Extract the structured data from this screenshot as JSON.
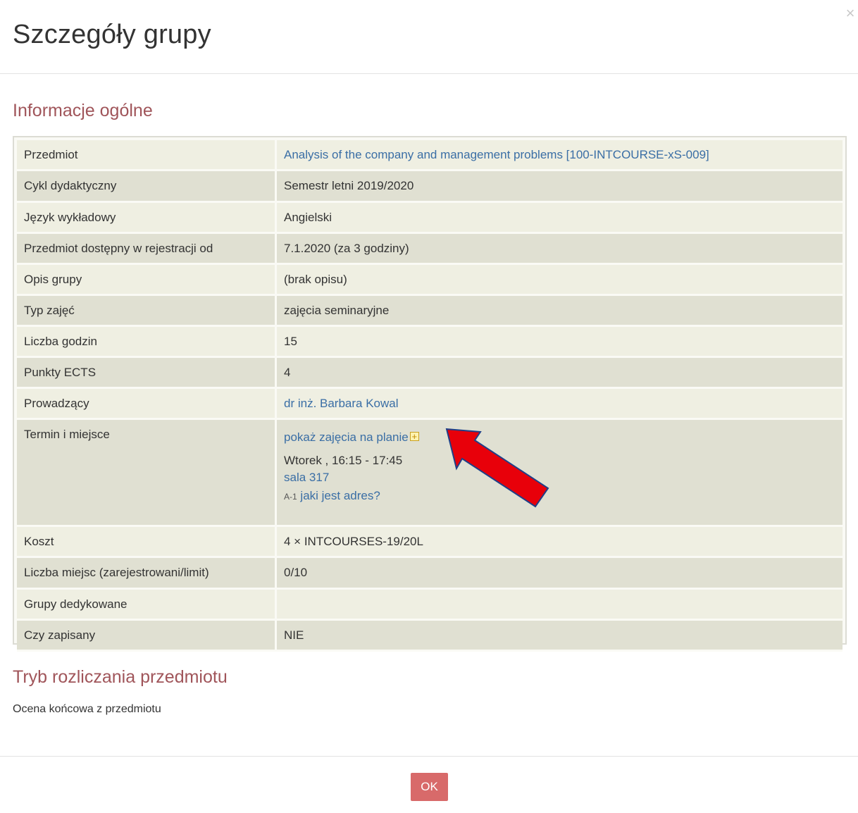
{
  "dialog": {
    "title": "Szczegóły grupy",
    "close_glyph": "×"
  },
  "general_section": {
    "heading": "Informacje ogólne",
    "rows": [
      {
        "label": "Przedmiot",
        "value": "Analysis of the company and management problems [100-INTCOURSE-xS-009]",
        "is_link": true
      },
      {
        "label": "Cykl dydaktyczny",
        "value": "Semestr letni 2019/2020"
      },
      {
        "label": "Język wykładowy",
        "value": "Angielski"
      },
      {
        "label": "Przedmiot dostępny w rejestracji od",
        "value": "7.1.2020 (za 3 godziny)"
      },
      {
        "label": "Opis grupy",
        "value": "(brak opisu)"
      },
      {
        "label": "Typ zajęć",
        "value": "zajęcia seminaryjne"
      },
      {
        "label": "Liczba godzin",
        "value": "15"
      },
      {
        "label": "Punkty ECTS",
        "value": "4"
      },
      {
        "label": "Prowadzący",
        "value": "dr inż. Barbara Kowal",
        "is_link": true
      },
      {
        "label": "Termin i miejsce",
        "schedule_link": "pokaż zajęcia na planie",
        "schedule_icon": "plus-icon",
        "time": "Wtorek , 16:15 - 17:45",
        "room_link": "sala 317",
        "building_code": "A-1",
        "address_link": "jaki jest adres?"
      },
      {
        "label": "Koszt",
        "value": "4 × INTCOURSES-19/20L"
      },
      {
        "label": "Liczba miejsc (zarejestrowani/limit)",
        "value": "0/10"
      },
      {
        "label": "Grupy dedykowane",
        "value": ""
      },
      {
        "label": "Czy zapisany",
        "value": "NIE"
      }
    ]
  },
  "settlement_section": {
    "heading": "Tryb rozliczania przedmiotu",
    "text": "Ocena końcowa z przedmiotu"
  },
  "footer": {
    "ok_label": "OK"
  },
  "colors": {
    "heading": "#a0555a",
    "link": "#3a6ea5",
    "ok_button": "#d86a6a",
    "annotation_arrow": "#e8000a"
  }
}
